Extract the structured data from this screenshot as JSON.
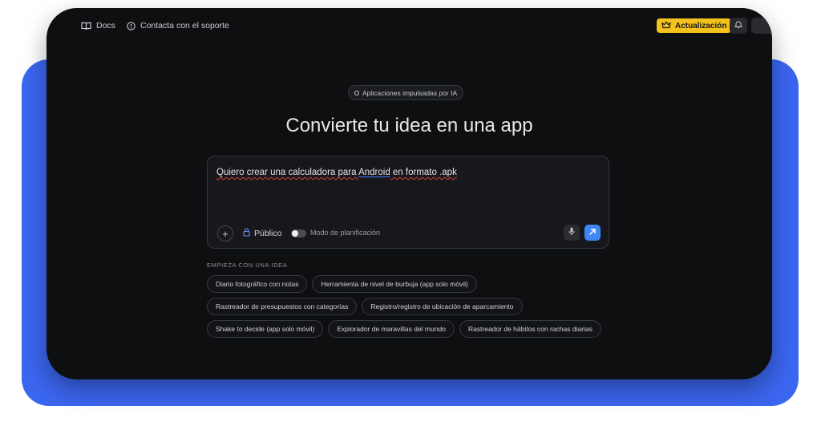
{
  "topbar": {
    "docs_label": "Docs",
    "support_label": "Contacta con el soporte",
    "upgrade_label": "Actualización",
    "icons": [
      "book-icon",
      "help-circle-icon",
      "crown-icon",
      "bell-icon"
    ]
  },
  "hero": {
    "badge": "Aplicaciones impulsadas por IA",
    "title": "Convierte tu idea en una app"
  },
  "prompt": {
    "text_parts": [
      "Quiero crear una calculadora para ",
      "Android",
      " en formato .apk"
    ],
    "visibility_label": "Público",
    "planning_mode_label": "Modo de planificación",
    "planning_mode_on": false
  },
  "ideas": {
    "heading": "EMPIEZA CON UNA IDEA",
    "rows": [
      [
        "Diario fotográfico con notas",
        "Herramienta de nivel de burbuja (app solo móvil)"
      ],
      [
        "Rastreador de presupuestos con categorías",
        "Registro/registro de ubicación de aparcamiento"
      ],
      [
        "Shake to decide (app solo móvil)",
        "Explorador de maravillas del mundo",
        "Rastreador de hábitos con rachas diarias"
      ]
    ]
  },
  "colors": {
    "backdrop": "#3b66f0",
    "app_bg": "#0e0f11",
    "upgrade": "#f4c21b",
    "send_button": "#3e86f7"
  }
}
